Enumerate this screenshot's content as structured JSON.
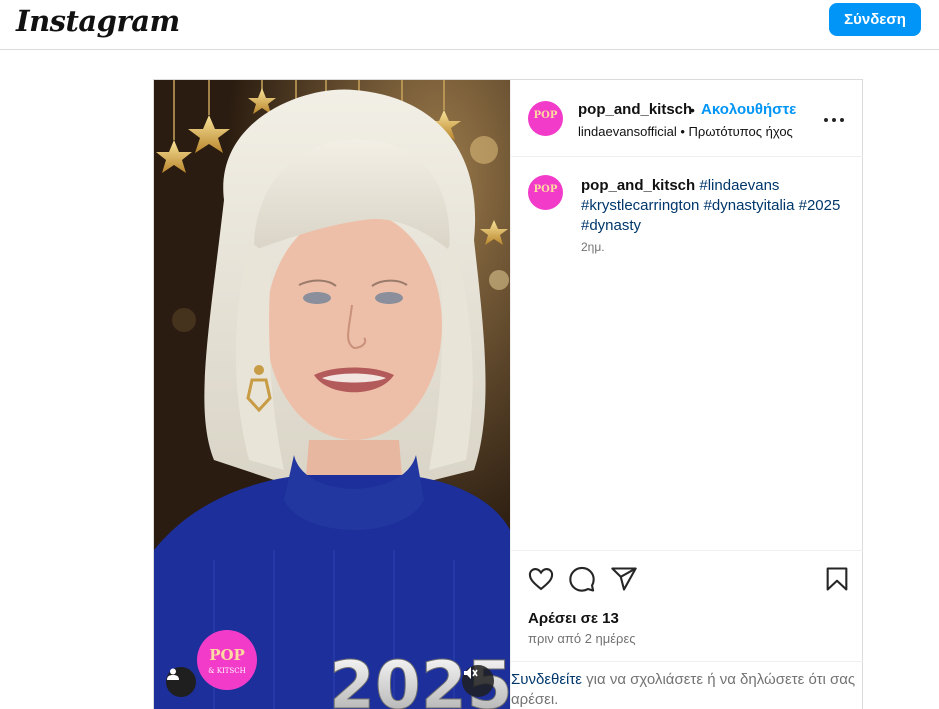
{
  "header": {
    "logo_text": "Instagram",
    "login_label": "Σύνδεση"
  },
  "post": {
    "author": {
      "username": "pop_and_kitsch",
      "avatar_text": "POP",
      "follow_label": "Ακολουθήστε",
      "separator": "•",
      "audio_text": "lindaevansofficial • Πρωτότυπος ήχος"
    },
    "caption": {
      "username": "pop_and_kitsch",
      "hashtags": [
        "#lindaevans",
        "#krystlecarrington",
        "#dynastyitalia",
        "#2025",
        "#dynasty"
      ],
      "time": "2ημ."
    },
    "media": {
      "year_overlay": "2025",
      "badge_line1": "POP",
      "badge_line2": "& KITSCH"
    },
    "stats": {
      "likes_text": "Αρέσει σε 13",
      "posted_text": "πριν από 2 ημέρες"
    },
    "login_prompt": {
      "link_text": "Συνδεθείτε",
      "rest_text": " για να σχολιάσετε ή να δηλώσετε ότι σας αρέσει."
    }
  },
  "colors": {
    "accent": "#0095f6",
    "link": "#00376b",
    "muted": "#737373",
    "border": "#dbdbdb",
    "avatar_bg": "#f23bc9",
    "sweater": "#1c2f9b"
  },
  "icons": [
    "heart-icon",
    "comment-icon",
    "share-icon",
    "bookmark-icon",
    "more-options-icon",
    "user-tag-icon",
    "muted-speaker-icon"
  ]
}
